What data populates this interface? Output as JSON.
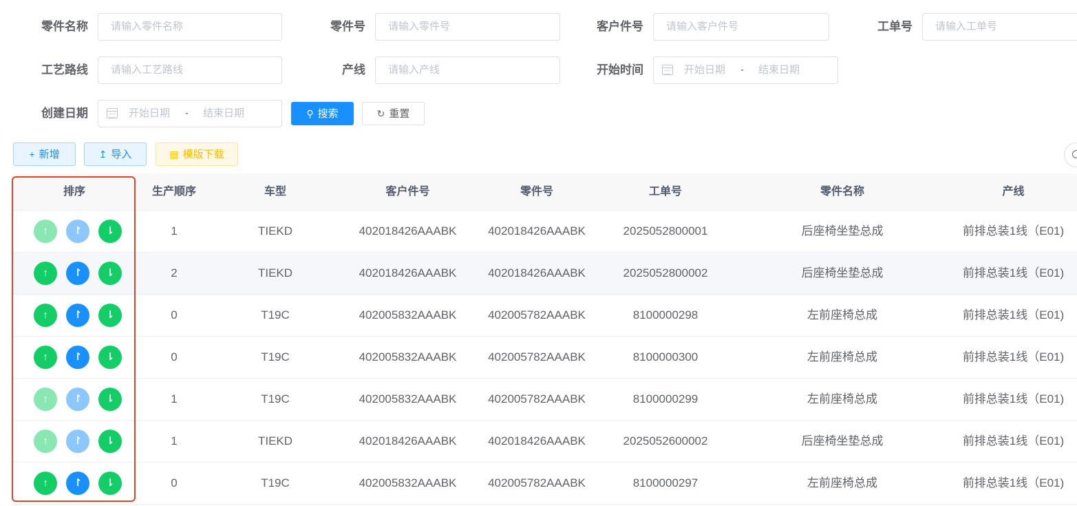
{
  "search_form": {
    "part_name": {
      "label": "零件名称",
      "placeholder": "请输入零件名称"
    },
    "part_no": {
      "label": "零件号",
      "placeholder": "请输入零件号"
    },
    "customer_part_no": {
      "label": "客户件号",
      "placeholder": "请输入客户件号"
    },
    "work_order_no": {
      "label": "工单号",
      "placeholder": "请输入工单号"
    },
    "process_route": {
      "label": "工艺路线",
      "placeholder": "请输入工艺路线"
    },
    "production_line": {
      "label": "产线",
      "placeholder": "请输入产线"
    },
    "start_time": {
      "label": "开始时间",
      "start_placeholder": "开始日期",
      "separator": "-",
      "end_placeholder": "结束日期"
    },
    "create_date": {
      "label": "创建日期",
      "start_placeholder": "开始日期",
      "separator": "-",
      "end_placeholder": "结束日期"
    },
    "search_label": "搜索",
    "reset_label": "重置"
  },
  "toolbar": {
    "add_label": "新增",
    "import_label": "导入",
    "template_label": "模版下载"
  },
  "icons": {
    "search": "search-icon",
    "reset": "refresh-icon",
    "add": "plus-icon",
    "import": "upload-icon",
    "template": "document-icon",
    "move_up": "arrow-up-icon",
    "move_top": "arrow-top-icon",
    "move_down": "arrow-down-icon"
  },
  "colors": {
    "primary": "#1890ff",
    "success": "#13ce66",
    "warning": "#ffba00",
    "highlight_border": "#e0432a"
  },
  "table": {
    "columns": [
      "排序",
      "生产顺序",
      "车型",
      "客户件号",
      "零件号",
      "工单号",
      "零件名称",
      "产线"
    ],
    "rows": [
      {
        "seq": "1",
        "model": "TIEKD",
        "customer_part_no": "402018426AAABK",
        "part_no": "402018426AAABK",
        "work_order_no": "2025052800001",
        "part_name": "后座椅坐垫总成",
        "line": "前排总装1线（E01)",
        "up_disabled": true,
        "top_disabled": true
      },
      {
        "seq": "2",
        "model": "TIEKD",
        "customer_part_no": "402018426AAABK",
        "part_no": "402018426AAABK",
        "work_order_no": "2025052800002",
        "part_name": "后座椅坐垫总成",
        "line": "前排总装1线（E01)",
        "up_disabled": false,
        "top_disabled": false
      },
      {
        "seq": "0",
        "model": "T19C",
        "customer_part_no": "402005832AAABK",
        "part_no": "402005782AAABK",
        "work_order_no": "8100000298",
        "part_name": "左前座椅总成",
        "line": "前排总装1线（E01)",
        "up_disabled": false,
        "top_disabled": false
      },
      {
        "seq": "0",
        "model": "T19C",
        "customer_part_no": "402005832AAABK",
        "part_no": "402005782AAABK",
        "work_order_no": "8100000300",
        "part_name": "左前座椅总成",
        "line": "前排总装1线（E01)",
        "up_disabled": false,
        "top_disabled": false
      },
      {
        "seq": "1",
        "model": "T19C",
        "customer_part_no": "402005832AAABK",
        "part_no": "402005782AAABK",
        "work_order_no": "8100000299",
        "part_name": "左前座椅总成",
        "line": "前排总装1线（E01)",
        "up_disabled": true,
        "top_disabled": true
      },
      {
        "seq": "1",
        "model": "TIEKD",
        "customer_part_no": "402018426AAABK",
        "part_no": "402018426AAABK",
        "work_order_no": "2025052600002",
        "part_name": "后座椅坐垫总成",
        "line": "前排总装1线（E01)",
        "up_disabled": true,
        "top_disabled": true
      },
      {
        "seq": "0",
        "model": "T19C",
        "customer_part_no": "402005832AAABK",
        "part_no": "402005782AAABK",
        "work_order_no": "8100000297",
        "part_name": "左前座椅总成",
        "line": "前排总装1线（E01)",
        "up_disabled": false,
        "top_disabled": false
      }
    ]
  }
}
